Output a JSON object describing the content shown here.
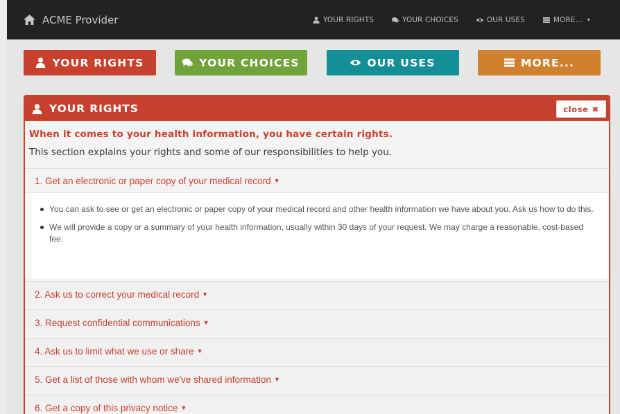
{
  "navbar": {
    "brand": "ACME Provider",
    "links": [
      {
        "label": "YOUR RIGHTS",
        "icon": "user-icon"
      },
      {
        "label": "YOUR CHOICES",
        "icon": "comments-icon"
      },
      {
        "label": "OUR USES",
        "icon": "eye-icon"
      },
      {
        "label": "MORE...",
        "icon": "list-icon"
      }
    ],
    "more_caret": "▾"
  },
  "buttons": {
    "rights": "YOUR RIGHTS",
    "choices": "YOUR CHOICES",
    "uses": "OUR USES",
    "more": "MORE..."
  },
  "colors": {
    "rights": "#c8412e",
    "choices": "#72a23a",
    "uses": "#138f95",
    "more": "#d0812f",
    "navbar": "#222222"
  },
  "panel": {
    "title": "YOUR RIGHTS",
    "close_label": "close",
    "close_glyph": "✖",
    "lead": "When it comes to your health information, you have certain rights.",
    "text": "This section explains your rights and some of our responsibilities to help you."
  },
  "accordion": {
    "open_item": {
      "label": "1. Get an electronic or paper copy of your medical record",
      "bullets": [
        "You can ask to see or get an electronic or paper copy of your medical record and other health information we have about you. Ask us how to do this.",
        "We will provide a copy or a summary of your health information, usually within 30 days of your request. We may charge a reasonable, cost-based fee."
      ]
    },
    "closed_items": [
      "2. Ask us to correct your medical record",
      "3. Request confidential communications",
      "4. Ask us to limit what we use or share",
      "5. Get a list of those with whom we've shared information",
      "6. Get a copy of this privacy notice"
    ],
    "caret": "▼"
  }
}
